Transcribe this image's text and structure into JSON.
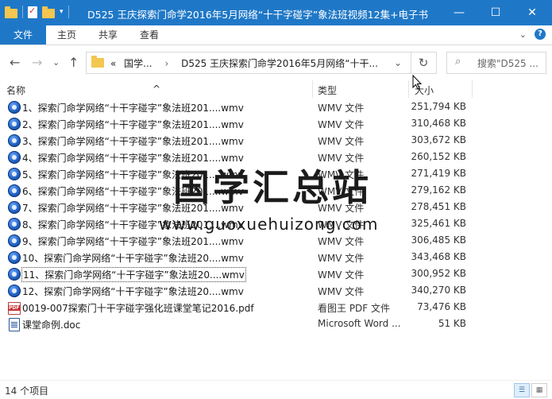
{
  "titlebar": {
    "title": "D525 王庆探索门命学2016年5月网络“十干字碰字”象法班视频12集+电子书",
    "minimize": "—",
    "maximize": "☐",
    "close": "✕"
  },
  "ribbon": {
    "tabs": [
      "文件",
      "主页",
      "共享",
      "查看"
    ],
    "expand": "⌄",
    "help": "?"
  },
  "nav": {
    "back": "←",
    "forward": "→",
    "recent": "⌄",
    "up": "↑",
    "breadcrumb_overflow": "«",
    "crumb1": "国学...",
    "crumb_sep": "›",
    "crumb2": "D525 王庆探索门命学2016年5月网络“十干...",
    "address_dropdown": "⌄",
    "refresh": "↻",
    "search_placeholder": "搜索\"D525 ..."
  },
  "columns": {
    "name": "名称",
    "type": "类型",
    "size": "大小"
  },
  "files": [
    {
      "name": "1、探索门命学网络“十干字碰字”象法班201....wmv",
      "type": "WMV 文件",
      "size": "251,794 KB",
      "icon": "wmv"
    },
    {
      "name": "2、探索门命学网络“十干字碰字”象法班201....wmv",
      "type": "WMV 文件",
      "size": "310,468 KB",
      "icon": "wmv"
    },
    {
      "name": "3、探索门命学网络“十干字碰字”象法班201....wmv",
      "type": "WMV 文件",
      "size": "303,672 KB",
      "icon": "wmv"
    },
    {
      "name": "4、探索门命学网络“十干字碰字”象法班201....wmv",
      "type": "WMV 文件",
      "size": "260,152 KB",
      "icon": "wmv"
    },
    {
      "name": "5、探索门命学网络“十干字碰字”象法班201....wmv",
      "type": "WMV 文件",
      "size": "271,419 KB",
      "icon": "wmv"
    },
    {
      "name": "6、探索门命学网络“十干字碰字”象法班201....wmv",
      "type": "WMV 文件",
      "size": "279,162 KB",
      "icon": "wmv"
    },
    {
      "name": "7、探索门命学网络“十干字碰字”象法班201....wmv",
      "type": "WMV 文件",
      "size": "278,451 KB",
      "icon": "wmv"
    },
    {
      "name": "8、探索门命学网络“十干字碰字”象法班201....wmv",
      "type": "WMV 文件",
      "size": "325,461 KB",
      "icon": "wmv"
    },
    {
      "name": "9、探索门命学网络“十干字碰字”象法班201....wmv",
      "type": "WMV 文件",
      "size": "306,485 KB",
      "icon": "wmv"
    },
    {
      "name": "10、探索门命学网络“十干字碰字”象法班20....wmv",
      "type": "WMV 文件",
      "size": "343,468 KB",
      "icon": "wmv"
    },
    {
      "name": "11、探索门命学网络“十干字碰字”象法班20....wmv",
      "type": "WMV 文件",
      "size": "300,952 KB",
      "icon": "wmv"
    },
    {
      "name": "12、探索门命学网络“十干字碰字”象法班20....wmv",
      "type": "WMV 文件",
      "size": "340,270 KB",
      "icon": "wmv"
    },
    {
      "name": "0019-007探索门十干字碰字强化班课堂笔记2016.pdf",
      "type": "看图王 PDF 文件",
      "size": "73,476 KB",
      "icon": "pdf"
    },
    {
      "name": "课堂命例.doc",
      "type": "Microsoft Word ...",
      "size": "51 KB",
      "icon": "doc"
    }
  ],
  "watermark": {
    "line1": "国学汇总站",
    "line2": "www.guoxuehuizong.com"
  },
  "status": {
    "count": "14 个项目"
  }
}
